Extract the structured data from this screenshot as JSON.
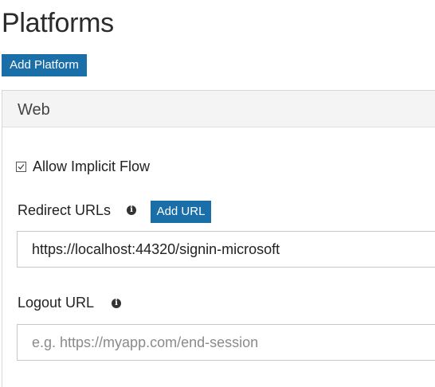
{
  "page": {
    "title": "Platforms",
    "add_platform_label": "Add Platform"
  },
  "web_panel": {
    "title": "Web",
    "allow_implicit_flow": {
      "label": "Allow Implicit Flow",
      "checked": true
    },
    "redirect_urls": {
      "label": "Redirect URLs",
      "info_icon": "info-circle-icon",
      "add_url_label": "Add URL",
      "value": "https://localhost:44320/signin-microsoft"
    },
    "logout_url": {
      "label": "Logout URL",
      "info_icon": "info-circle-icon",
      "placeholder": "e.g. https://myapp.com/end-session",
      "value": ""
    }
  },
  "colors": {
    "accent": "#1a6fa8",
    "panel_header_bg": "#f4f4f4",
    "border": "#c8c8c8"
  }
}
